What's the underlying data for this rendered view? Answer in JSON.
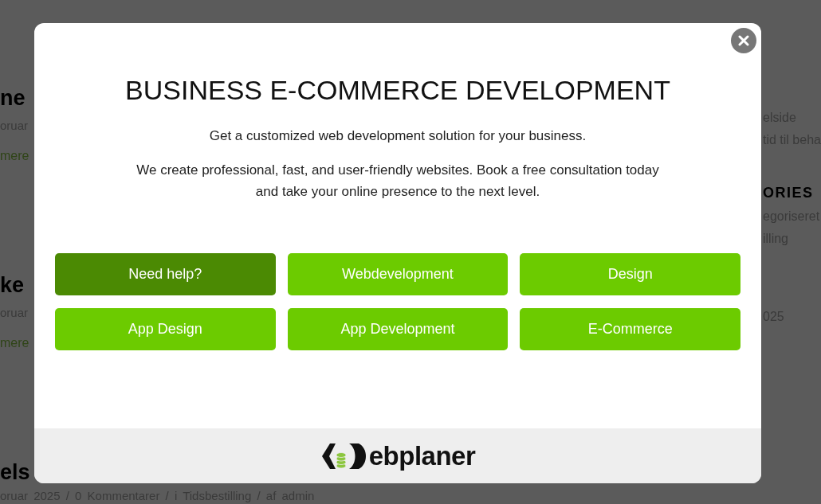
{
  "background": {
    "posts": [
      {
        "title": "ne",
        "meta": "oruar",
        "link": "mere"
      },
      {
        "title": "ke",
        "meta": "oruar",
        "link": "mere"
      },
      {
        "title": "els",
        "meta": "oruar 2025 / 0 Kommentarer / i Tidsbestilling / af admin"
      }
    ],
    "sidebar": [
      {
        "lines": [
          "elside",
          "tid til beha"
        ]
      },
      {
        "heading": "ORIES",
        "lines": [
          "egoriseret",
          "illing"
        ]
      },
      {
        "lines": [
          "025"
        ]
      }
    ]
  },
  "modal": {
    "title": "BUSINESS E-COMMERCE DEVELOPMENT",
    "intro": "Get a customized web development solution for your business.",
    "text": "We create professional, fast, and user-friendly websites. Book a free consultation today and take your online presence to the next level.",
    "buttons": [
      {
        "label": "Need help?",
        "selected": true
      },
      {
        "label": "Webdevelopment",
        "selected": false
      },
      {
        "label": "Design",
        "selected": false
      },
      {
        "label": "App Design",
        "selected": false
      },
      {
        "label": "App Development",
        "selected": false
      },
      {
        "label": "E-Commerce",
        "selected": false
      }
    ],
    "logo_text": "ebplaner"
  }
}
